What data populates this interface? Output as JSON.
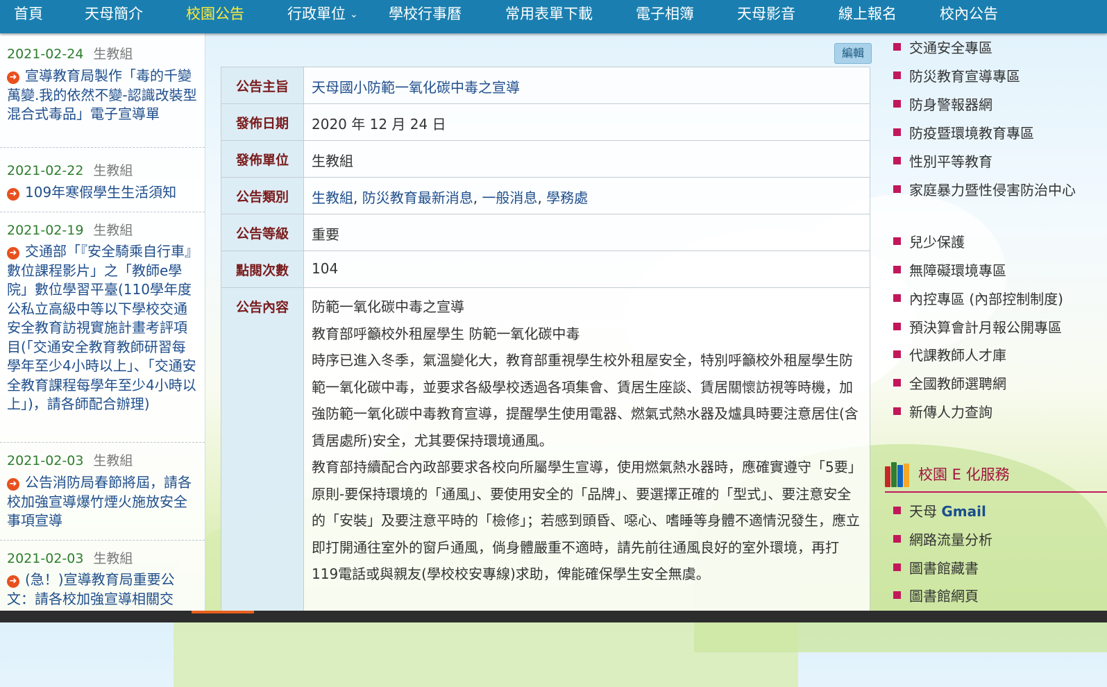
{
  "nav": {
    "items": [
      "首頁",
      "天母簡介",
      "校園公告",
      "行政單位",
      "學校行事曆",
      "常用表單下載",
      "電子相簿",
      "天母影音",
      "線上報名",
      "校內公告"
    ],
    "active_index": 2,
    "dropdown_index": 3
  },
  "news": {
    "items": [
      {
        "date": "2021-02-24",
        "unit": "生教組",
        "title": "宣導教育局製作「毒的千變萬變.我的依然不變-認識改裝型混合式毒品」電子宣導單"
      },
      {
        "date": "2021-02-22",
        "unit": "生教組",
        "title": "109年寒假學生生活須知"
      },
      {
        "date": "2021-02-19",
        "unit": "生教組",
        "title": "交通部「『安全騎乘自行車』數位課程影片」之「教師e學院」數位學習平臺(110學年度公私立高級中等以下學校交通安全教育訪視實施計畫考評項目(「交通安全教育教師研習每學年至少4小時以上」、「交通安全教育課程每學年至少4小時以上」)，請各師配合辦理)"
      },
      {
        "date": "2021-02-03",
        "unit": "生教組",
        "title": "公告消防局春節將屆，請各校加強宣導爆竹煙火施放安全事項宣導"
      },
      {
        "date": "2021-02-03",
        "unit": "生教組",
        "title": "(急！)宣導教育局重要公文：請各校加強宣導相關交"
      }
    ]
  },
  "edit_label": "編輯",
  "announcement": {
    "subject_label": "公告主旨",
    "subject": "天母國小防範一氧化碳中毒之宣導",
    "date_label": "發佈日期",
    "date": "2020 年 12 月 24 日",
    "unit_label": "發佈單位",
    "unit": "生教組",
    "category_label": "公告類別",
    "categories": [
      "生教組",
      "防災教育最新消息",
      "一般消息",
      "學務處"
    ],
    "category_separator": ", ",
    "level_label": "公告等級",
    "level": "重要",
    "views_label": "點閱次數",
    "views": "104",
    "content_label": "公告內容",
    "content": [
      "防範一氧化碳中毒之宣導",
      "教育部呼籲校外租屋學生 防範一氧化碳中毒",
      "時序已進入冬季，氣溫變化大，教育部重視學生校外租屋安全，特別呼籲校外租屋學生防範一氧化碳中毒，並要求各級學校透過各項集會、賃居生座談、賃居關懷訪視等時機，加強防範一氧化碳中毒教育宣導，提醒學生使用電器、燃氣式熱水器及爐具時要注意居住(含賃居處所)安全，尤其要保持環境通風。",
      "教育部持續配合內政部要求各校向所屬學生宣導，使用燃氣熱水器時，應確實遵守「5要」原則-要保持環境的「通風」、要使用安全的「品牌」、要選擇正確的「型式」、要注意安全的「安裝」及要注意平時的「檢修」；若感到頭昏、噁心、嗜睡等身體不適情況發生，應立即打開通往室外的窗戶通風，倘身體嚴重不適時，請先前往通風良好的室外環境，再打119電話或與親友(學校校安專線)求助，俾能確保學生安全無虞。"
    ]
  },
  "special_zone": {
    "items": [
      "交通安全專區",
      "防災教育宣導專區",
      "防身警報器網",
      "防疫暨環境教育專區",
      "性別平等教育",
      "家庭暴力暨性侵害防治中心",
      "兒少保護",
      "無障礙環境專區",
      "內控專區 (內部控制制度)",
      "預決算會計月報公開專區",
      "代課教師人才庫",
      "全國教師選聘網",
      "新傳人力查詢"
    ]
  },
  "e_services": {
    "title": "校園 E 化服務",
    "gmail_prefix": "天母 ",
    "gmail_bold": "Gmail",
    "items": [
      "網路流量分析",
      "圖書館藏書",
      "圖書館網頁"
    ]
  },
  "colors": {
    "nav_bg": "#1a7fb0",
    "nav_active": "#ffeb3b",
    "label_red": "#7a1c1c",
    "accent_magenta": "#c2185b",
    "link_blue": "#1f4e8c",
    "date_green": "#2d7d2d",
    "arrow_orange": "#e8501e"
  },
  "icons": {
    "news_arrow": "arrow-circle-right-icon",
    "list_bullet": "square-bullet-icon",
    "section_books": "books-icon",
    "dropdown": "chevron-down-icon"
  }
}
